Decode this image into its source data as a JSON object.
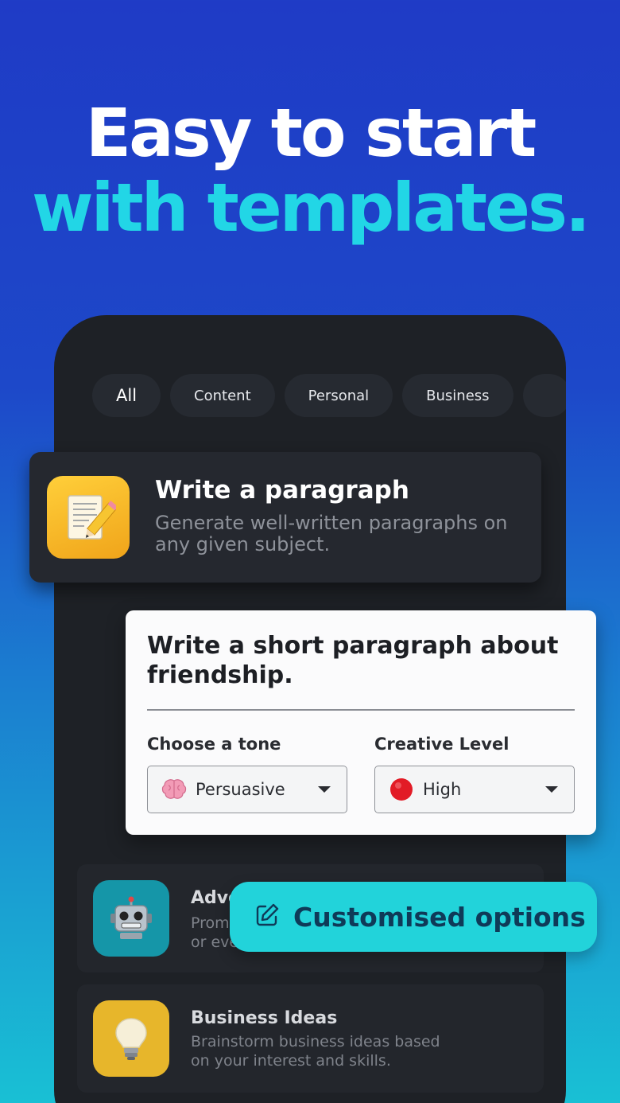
{
  "headline": {
    "line1": "Easy to start",
    "line2": "with templates.",
    "line1_color": "#ffffff",
    "line2_color": "#22d6e6"
  },
  "chips": [
    "All",
    "Content",
    "Personal",
    "Business"
  ],
  "featured_template": {
    "icon": "memo-pencil-icon",
    "title": "Write a paragraph",
    "description": "Generate well-written paragraphs on any given subject."
  },
  "prompt_card": {
    "prompt": "Write a short paragraph about friendship.",
    "tone_label": "Choose a tone",
    "tone_value": "Persuasive",
    "tone_icon": "brain-icon",
    "level_label": "Creative Level",
    "level_value": "High",
    "level_icon": "red-circle-icon"
  },
  "templates": [
    {
      "icon": "robot-icon",
      "title": "Adve",
      "description_line1": "Prom",
      "description_line2": "or eve",
      "tile_color": "#1596a8"
    },
    {
      "icon": "light-bulb-icon",
      "title": "Business Ideas",
      "description_line1": "Brainstorm business ideas based",
      "description_line2": "on your interest and skills.",
      "tile_color": "#e7b62b"
    }
  ],
  "toast": {
    "icon": "edit-icon",
    "label": "Customised options"
  },
  "colors": {
    "background_top": "#1f3bc6",
    "background_bottom": "#19c0d4",
    "phone": "#1e2126",
    "accent": "#22d3da"
  }
}
